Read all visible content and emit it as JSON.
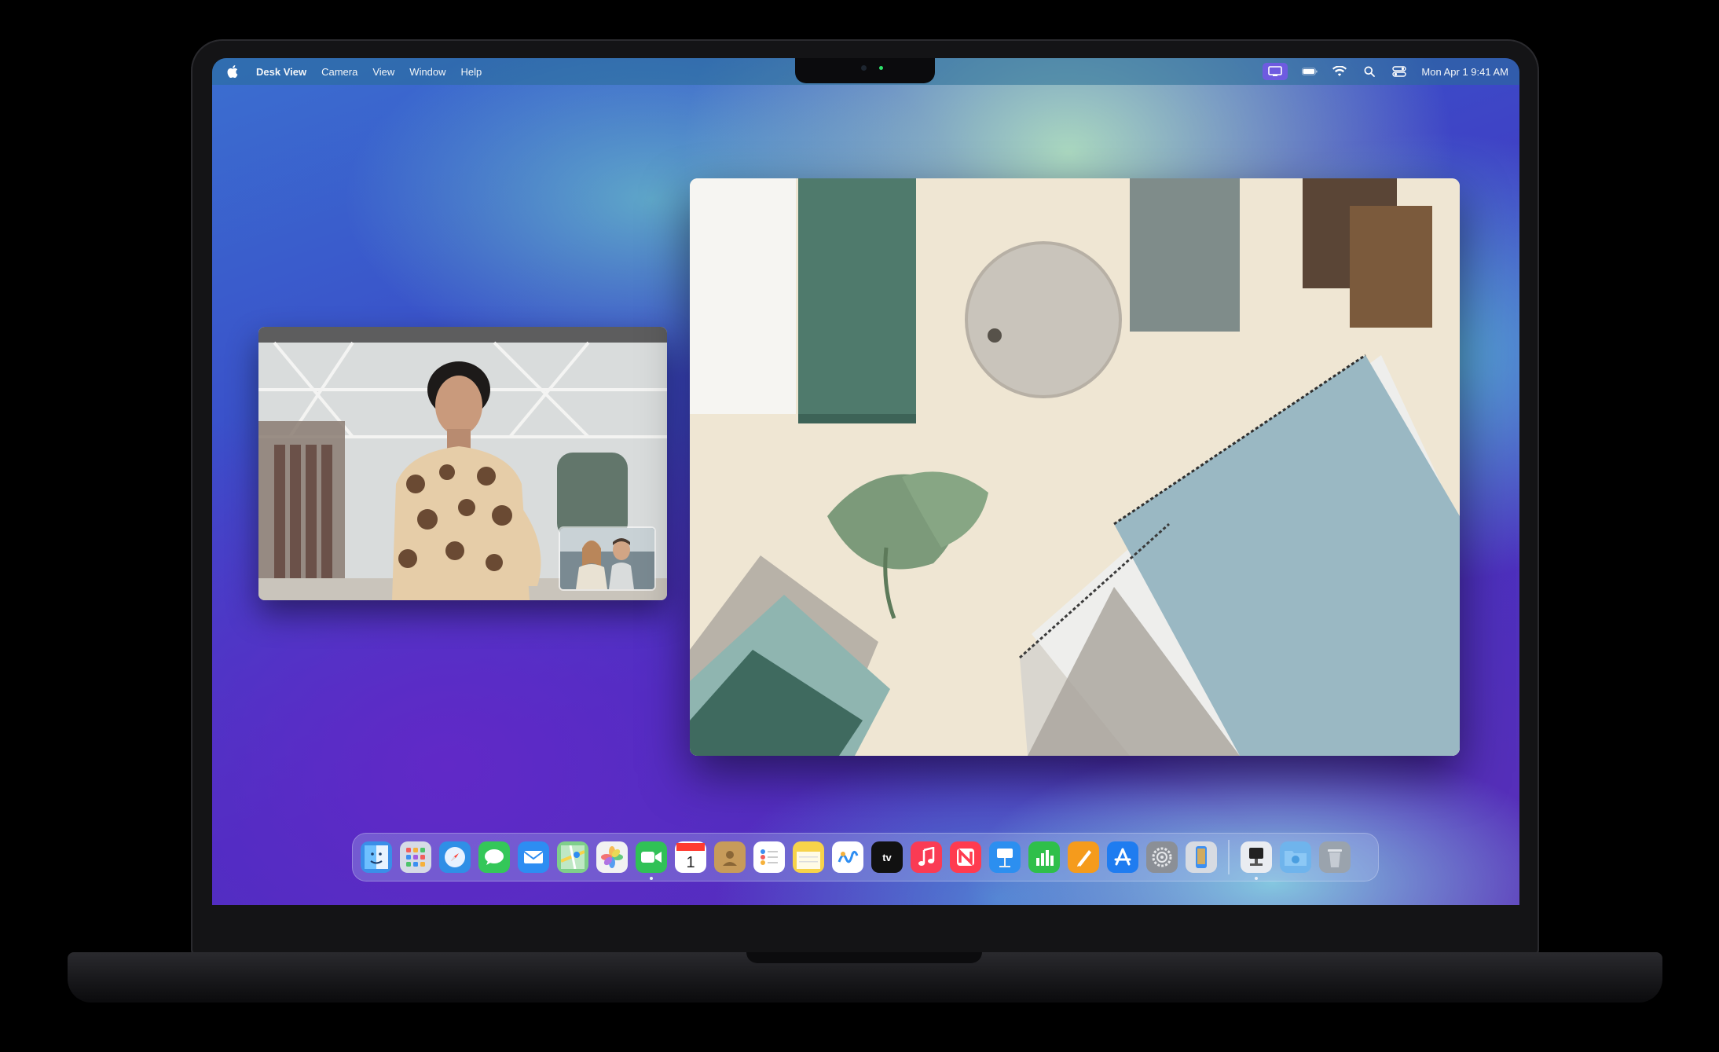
{
  "menubar": {
    "apple_icon": "apple-logo-icon",
    "app_name": "Desk View",
    "menus": [
      "Camera",
      "View",
      "Window",
      "Help"
    ],
    "clock": "Mon Apr 1  9:41 AM",
    "status_icons": [
      "desk-view-icon",
      "battery-icon",
      "wifi-icon",
      "search-icon",
      "control-center-icon"
    ]
  },
  "windows": {
    "facetime": {
      "content": "facetime-video-call",
      "pip": "self-view"
    },
    "desk_view": {
      "content": "overhead-desk-camera-view"
    }
  },
  "dock": {
    "apps": [
      {
        "icon": "finder-icon",
        "color": "#3a8ee8",
        "running": false
      },
      {
        "icon": "launchpad-icon",
        "color": "#d6dbe6",
        "running": false
      },
      {
        "icon": "safari-icon",
        "color": "#2f8fe6",
        "running": false
      },
      {
        "icon": "messages-icon",
        "color": "#34c759",
        "running": false
      },
      {
        "icon": "mail-icon",
        "color": "#2d8df2",
        "running": false
      },
      {
        "icon": "maps-icon",
        "color": "#7fcf8a",
        "running": false
      },
      {
        "icon": "photos-icon",
        "color": "#f2f2f2",
        "running": false
      },
      {
        "icon": "facetime-icon",
        "color": "#30c156",
        "running": true
      },
      {
        "icon": "calendar-icon",
        "color": "#ffffff",
        "running": false,
        "glyph": "1"
      },
      {
        "icon": "contacts-icon",
        "color": "#c79b5a",
        "running": false
      },
      {
        "icon": "reminders-icon",
        "color": "#ffffff",
        "running": false
      },
      {
        "icon": "notes-icon",
        "color": "#f7d34a",
        "running": false
      },
      {
        "icon": "freeform-icon",
        "color": "#ffffff",
        "running": false
      },
      {
        "icon": "apple-tv-icon",
        "color": "#111111",
        "running": false,
        "glyph": "tv"
      },
      {
        "icon": "music-icon",
        "color": "#fa3b54",
        "running": false,
        "glyph": "♫"
      },
      {
        "icon": "news-icon",
        "color": "#ff3b4f",
        "running": false
      },
      {
        "icon": "keynote-icon",
        "color": "#2c8ff0",
        "running": false
      },
      {
        "icon": "numbers-icon",
        "color": "#2fbf4a",
        "running": false
      },
      {
        "icon": "pages-icon",
        "color": "#f59b1c",
        "running": false
      },
      {
        "icon": "app-store-icon",
        "color": "#1f7cf0",
        "running": false
      },
      {
        "icon": "system-settings-icon",
        "color": "#8b8f96",
        "running": false
      },
      {
        "icon": "iphone-mirroring-icon",
        "color": "#d7dbe2",
        "running": false
      }
    ],
    "after_separator": [
      {
        "icon": "desk-view-app-icon",
        "color": "#e9ecf1",
        "running": true
      },
      {
        "icon": "downloads-folder-icon",
        "color": "#6fb4ec",
        "running": false
      },
      {
        "icon": "trash-icon",
        "color": "#9aa3ad",
        "running": false
      }
    ]
  }
}
